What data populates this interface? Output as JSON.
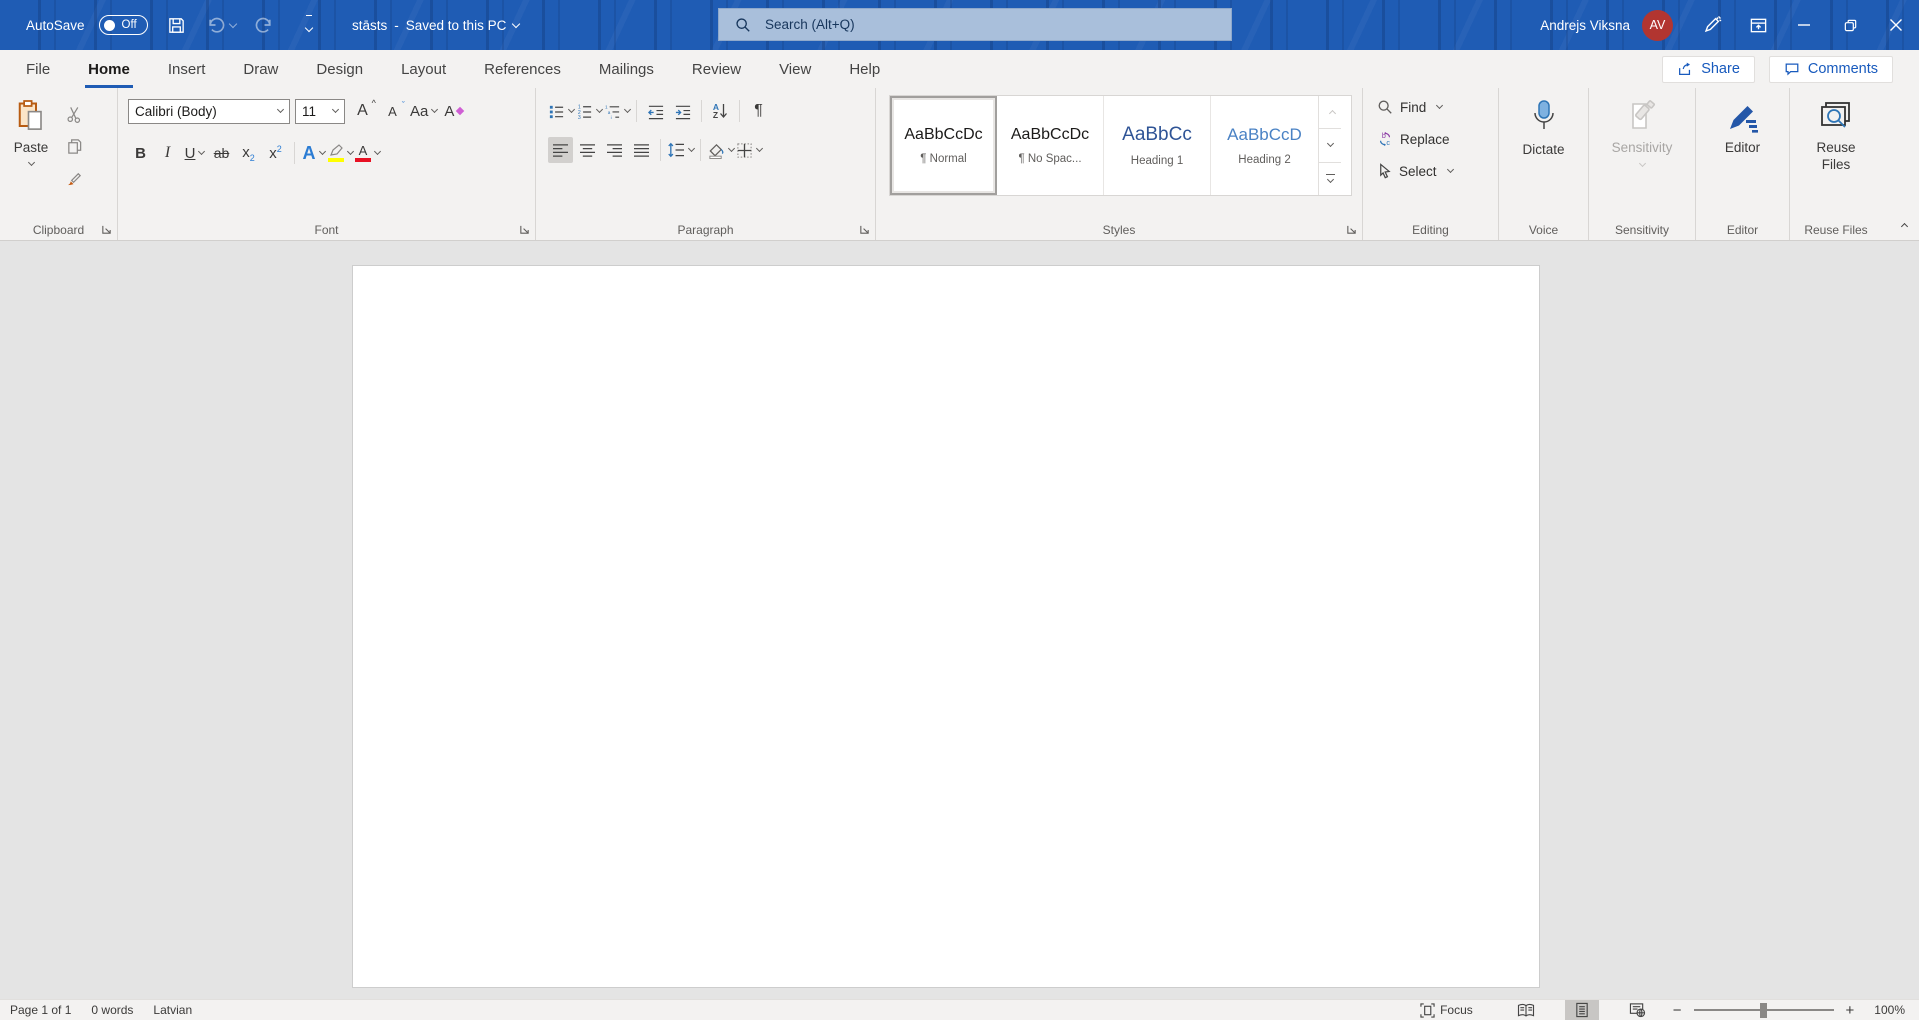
{
  "titlebar": {
    "autosave_label": "AutoSave",
    "autosave_state": "Off",
    "doc_title": "stāsts",
    "separator": "-",
    "doc_status": "Saved to this PC",
    "search_placeholder": "Search (Alt+Q)",
    "user_name": "Andrejs Viksna",
    "user_initials": "AV",
    "colors": {
      "bar": "#1f5cb4",
      "search_bg": "#a9bfdb",
      "avatar": "#b23530"
    }
  },
  "tabs": {
    "items": [
      "File",
      "Home",
      "Insert",
      "Draw",
      "Design",
      "Layout",
      "References",
      "Mailings",
      "Review",
      "View",
      "Help"
    ],
    "active": "Home",
    "share_label": "Share",
    "comments_label": "Comments"
  },
  "ribbon": {
    "clipboard": {
      "group_label": "Clipboard",
      "paste_label": "Paste"
    },
    "font": {
      "group_label": "Font",
      "font_name": "Calibri (Body)",
      "font_size": "11",
      "grow": "A",
      "shrink": "A",
      "case_label": "Aa",
      "clear": "A",
      "bold": "B",
      "italic": "I",
      "underline": "U",
      "strike": "ab",
      "sub_base": "x",
      "sub_script": "2",
      "sup_base": "x",
      "sup_script": "2",
      "effects": "A",
      "color_label": "A",
      "highlight_color": "#ffff00",
      "font_color": "#e81123"
    },
    "paragraph": {
      "group_label": "Paragraph",
      "sort_a": "A",
      "sort_z": "Z",
      "pilcrow": "¶"
    },
    "styles": {
      "group_label": "Styles",
      "items": [
        {
          "preview": "AaBbCcDc",
          "name": "¶ Normal",
          "color": "#1b1a19"
        },
        {
          "preview": "AaBbCcDc",
          "name": "¶ No Spac...",
          "color": "#1b1a19"
        },
        {
          "preview": "AaBbCc",
          "name": "Heading 1",
          "color": "#2F5496"
        },
        {
          "preview": "AaBbCcD",
          "name": "Heading 2",
          "color": "#4a82c4"
        }
      ]
    },
    "editing": {
      "group_label": "Editing",
      "find": "Find",
      "replace": "Replace",
      "select": "Select"
    },
    "voice": {
      "group_label": "Voice",
      "dictate_label": "Dictate"
    },
    "sensitivity": {
      "group_label": "Sensitivity",
      "button_label": "Sensitivity"
    },
    "editor": {
      "group_label": "Editor",
      "button_label": "Editor"
    },
    "reuse": {
      "group_label": "Reuse Files",
      "button_label": "Reuse Files"
    }
  },
  "statusbar": {
    "page": "Page 1 of 1",
    "words": "0 words",
    "language": "Latvian",
    "focus_label": "Focus",
    "zoom_value": "100%"
  }
}
